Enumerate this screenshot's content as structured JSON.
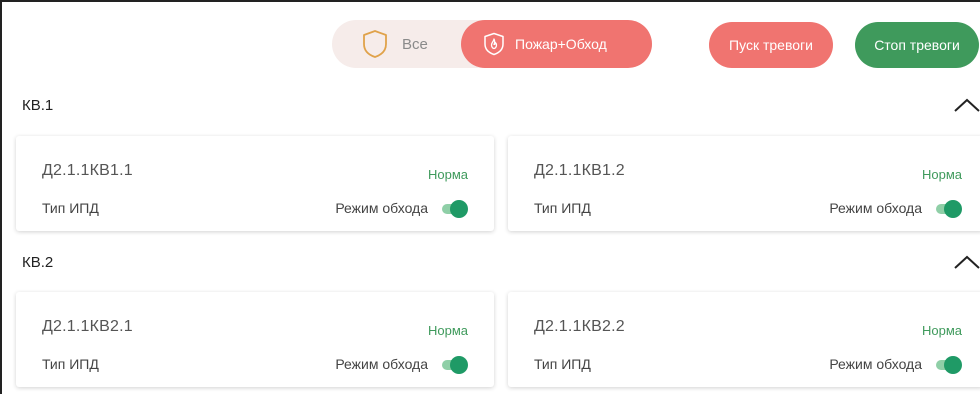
{
  "filters": {
    "all_label": "Все",
    "fire_bypass_label": "Пожар+Обход"
  },
  "actions": {
    "start_alarm_label": "Пуск тревоги",
    "stop_alarm_label": "Стоп тревоги"
  },
  "colors": {
    "accent_red": "#f07470",
    "accent_green": "#3f9a5c",
    "toggle_on": "#1f9a66"
  },
  "groups": [
    {
      "title": "КВ.1",
      "devices": [
        {
          "name": "Д2.1.1КВ1.1",
          "status": "Норма",
          "type": "Тип ИПД",
          "mode_label": "Режим обхода",
          "bypass_on": true
        },
        {
          "name": "Д2.1.1КВ1.2",
          "status": "Норма",
          "type": "Тип ИПД",
          "mode_label": "Режим обхода",
          "bypass_on": true
        }
      ]
    },
    {
      "title": "КВ.2",
      "devices": [
        {
          "name": "Д2.1.1КВ2.1",
          "status": "Норма",
          "type": "Тип ИПД",
          "mode_label": "Режим обхода",
          "bypass_on": true
        },
        {
          "name": "Д2.1.1КВ2.2",
          "status": "Норма",
          "type": "Тип ИПД",
          "mode_label": "Режим обхода",
          "bypass_on": true
        }
      ]
    }
  ]
}
